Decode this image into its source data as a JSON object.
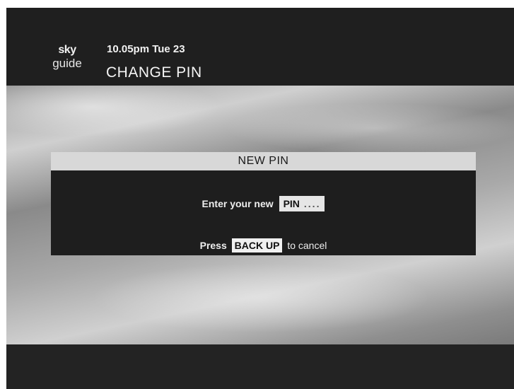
{
  "header": {
    "logo_line1": "sky",
    "logo_line2": "guide",
    "datetime": "10.05pm Tue 23",
    "title": "CHANGE PIN"
  },
  "dialog": {
    "title": "NEW PIN",
    "prompt": "Enter your new",
    "pin_label": "PIN",
    "pin_placeholder": "....",
    "cancel_prefix": "Press",
    "cancel_key": "BACK UP",
    "cancel_suffix": "to cancel"
  }
}
